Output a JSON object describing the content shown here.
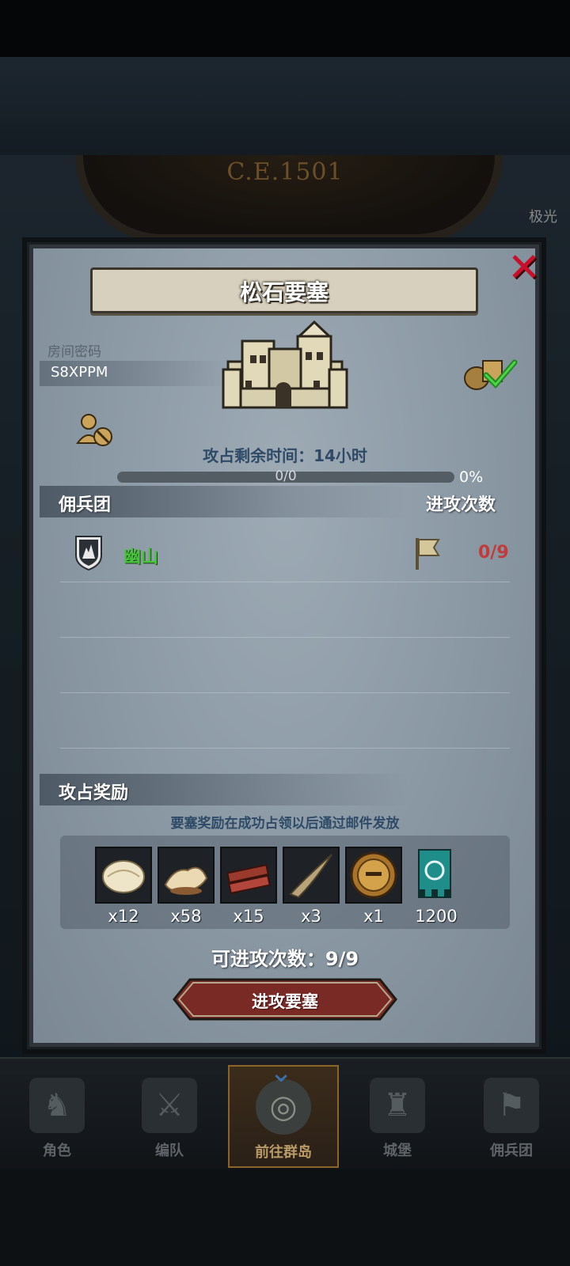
{
  "background": {
    "era": "C.E.1501",
    "side_label": "极光"
  },
  "dialog": {
    "title": "松石要塞",
    "close_icon": "close-x-icon",
    "room_code_label": "房间密码",
    "room_code": "S8XPPM",
    "time_label": "攻占剩余时间：14小时",
    "progress": {
      "value_text": "0/0",
      "percent_text": "0%",
      "fraction": 0.0
    },
    "merc_section": {
      "left_label": "佣兵团",
      "right_label": "进攻次数"
    },
    "merc_rows": [
      {
        "name": "幽山",
        "attacks": "0/9",
        "icon": "shield-emblem-icon",
        "flag_icon": "flag-icon"
      }
    ],
    "reward_section": {
      "label": "攻占奖励",
      "note": "要塞奖励在成功占领以后通过邮件发放"
    },
    "rewards": [
      {
        "icon": "fur-pelt-icon",
        "count": "x12"
      },
      {
        "icon": "wool-hide-icon",
        "count": "x58"
      },
      {
        "icon": "wood-planks-icon",
        "count": "x15"
      },
      {
        "icon": "horn-icon",
        "count": "x3"
      },
      {
        "icon": "helmet-medal-icon",
        "count": "x1"
      },
      {
        "icon": "guild-banner-icon",
        "count": "1200"
      }
    ],
    "attack_count_label": "可进攻次数：9/9",
    "attack_button_label": "进攻要塞"
  },
  "nav": {
    "items": [
      {
        "label": "角色",
        "icon": "knight-icon",
        "active": false
      },
      {
        "label": "编队",
        "icon": "formation-icon",
        "active": false
      },
      {
        "label": "前往群岛",
        "icon": "globe-icon",
        "active": true
      },
      {
        "label": "城堡",
        "icon": "castle-icon",
        "active": false
      },
      {
        "label": "佣兵团",
        "icon": "mercenary-icon",
        "active": false
      }
    ]
  },
  "colors": {
    "accent_green": "#46c23b",
    "attack_red": "#c23a3a",
    "close_red": "#c8102a",
    "nav_active_gold": "#b89a66"
  }
}
